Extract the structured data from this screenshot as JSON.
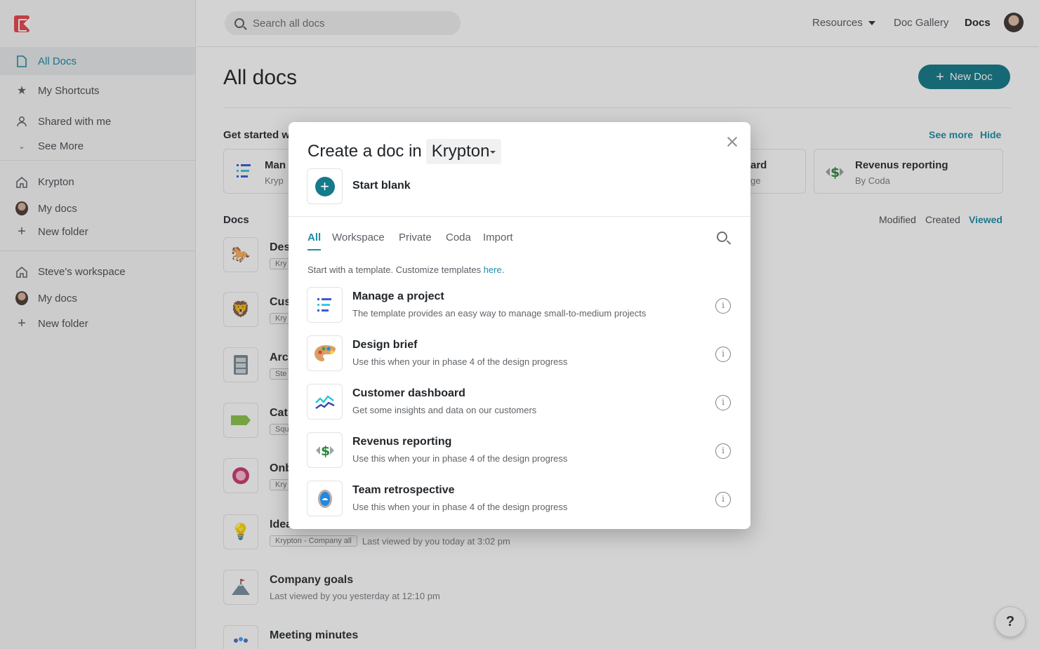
{
  "sidebar": {
    "items": [
      {
        "label": "All Docs"
      },
      {
        "label": "My Shortcuts"
      },
      {
        "label": "Shared with me"
      },
      {
        "label": "See More"
      },
      {
        "label": "Krypton"
      },
      {
        "label": "My docs"
      },
      {
        "label": "New folder"
      },
      {
        "label": "Steve's workspace"
      },
      {
        "label": "My docs"
      },
      {
        "label": "New folder"
      }
    ]
  },
  "topbar": {
    "search_placeholder": "Search all docs",
    "resources": "Resources",
    "gallery": "Doc Gallery",
    "docs": "Docs"
  },
  "main": {
    "title": "All docs",
    "new_doc": "New Doc",
    "get_started": "Get started w",
    "see_more": "See more",
    "hide": "Hide",
    "cards": [
      {
        "title": "Man",
        "sub": "Kryp"
      },
      {
        "title": "ard",
        "sub": "ge"
      },
      {
        "title": "Revenus reporting",
        "sub": "By Coda"
      }
    ],
    "docs_label": "Docs",
    "sort": {
      "modified": "Modified",
      "created": "Created",
      "viewed": "Viewed"
    },
    "docs": [
      {
        "title": "Des",
        "tag": "Kry",
        "meta": ""
      },
      {
        "title": "Cus",
        "tag": "Kry",
        "meta": ""
      },
      {
        "title": "Arc",
        "tag": "Ste",
        "meta": ""
      },
      {
        "title": "Cat",
        "tag": "Squ",
        "meta": ""
      },
      {
        "title": "Onb",
        "tag": "Kry",
        "meta": ""
      },
      {
        "title": "Idea",
        "tag": "Krypton - Company all",
        "meta": "Last viewed by you today at 3:02 pm"
      },
      {
        "title": "Company goals",
        "tag": "",
        "meta": "Last viewed by you yesterday at 12:10 pm"
      },
      {
        "title": "Meeting minutes",
        "tag": "",
        "meta": ""
      }
    ]
  },
  "help": "?",
  "modal": {
    "title": "Create a doc in",
    "workspace": "Krypton",
    "start_blank": "Start blank",
    "tabs": [
      "All",
      "Workspace",
      "Private",
      "Coda",
      "Import"
    ],
    "hint_prefix": "Start with a template. Customize templates ",
    "hint_link": "here",
    "hint_suffix": ".",
    "templates": [
      {
        "name": "Manage a project",
        "desc": "The template provides an easy way to manage small-to-medium projects",
        "icon": "project-icon"
      },
      {
        "name": "Design brief",
        "desc": "Use this when your in phase 4 of the design progress",
        "icon": "palette-icon"
      },
      {
        "name": "Customer dashboard",
        "desc": "Get some insights and data on our customers",
        "icon": "chart-line-icon"
      },
      {
        "name": "Revenus reporting",
        "desc": "Use this when your in phase 4 of the design progress",
        "icon": "dollar-icon"
      },
      {
        "name": "Team retrospective",
        "desc": "Use this when your in phase 4 of the design progress",
        "icon": "mirror-icon"
      }
    ],
    "info_glyph": "i"
  }
}
